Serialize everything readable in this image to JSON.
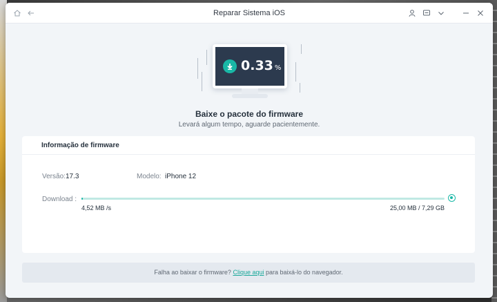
{
  "window": {
    "title": "Reparar Sistema iOS"
  },
  "titlebar_icons": {
    "home": "home-icon",
    "back": "back-arrow-icon",
    "account": "user-icon",
    "feedback": "feedback-icon",
    "menu": "chevron-down-icon",
    "minimize": "minimize-icon",
    "close": "close-icon"
  },
  "download": {
    "percent_value": "0.33",
    "percent_unit": "%",
    "progress_fraction": 0.0033,
    "heading": "Baixe o pacote do firmware",
    "subheading": "Levará algum tempo, aguarde pacientemente."
  },
  "firmware": {
    "card_title": "Informação de firmware",
    "version_label": "Versão:",
    "version_value": "17.3",
    "model_label": "Modelo:",
    "model_value": "iPhone 12",
    "download_label": "Download :",
    "speed": "4,52 MB /s",
    "size": "25,00 MB / 7,29 GB"
  },
  "footer": {
    "text_before": "Falha ao baixar o firmware?",
    "link_text": "Clique aqui",
    "text_after": "para baixá-lo do navegador."
  },
  "colors": {
    "accent": "#19b7a6",
    "window_bg": "#f2f5f8",
    "screen_bg": "#2c3a4e"
  }
}
